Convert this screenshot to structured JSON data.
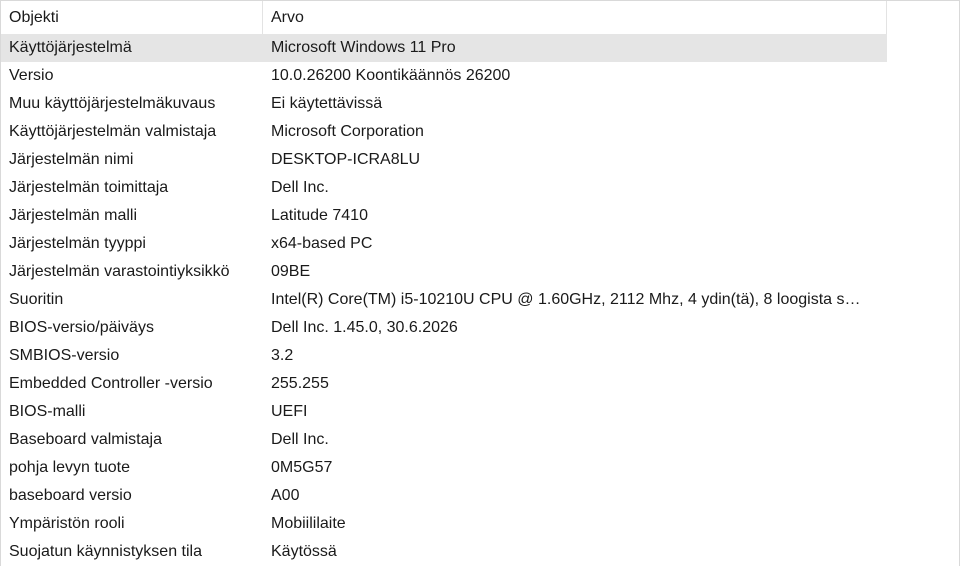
{
  "columns": {
    "item": "Objekti",
    "value": "Arvo"
  },
  "selected_index": 0,
  "rows": [
    {
      "item": "Käyttöjärjestelmä",
      "value": "Microsoft Windows 11 Pro"
    },
    {
      "item": "Versio",
      "value": "10.0.26200 Koontikäännös 26200"
    },
    {
      "item": "Muu käyttöjärjestelmäkuvaus",
      "value": "Ei käytettävissä"
    },
    {
      "item": "Käyttöjärjestelmän valmistaja",
      "value": "Microsoft Corporation"
    },
    {
      "item": "Järjestelmän nimi",
      "value": "DESKTOP-ICRA8LU"
    },
    {
      "item": "Järjestelmän toimittaja",
      "value": "Dell Inc."
    },
    {
      "item": "Järjestelmän malli",
      "value": "Latitude 7410"
    },
    {
      "item": "Järjestelmän tyyppi",
      "value": "x64-based PC"
    },
    {
      "item": "Järjestelmän varastointiyksikkö",
      "value": "09BE"
    },
    {
      "item": "Suoritin",
      "value": "Intel(R) Core(TM) i5-10210U CPU @ 1.60GHz, 2112 Mhz, 4 ydin(tä), 8 loogista s…"
    },
    {
      "item": "BIOS-versio/päiväys",
      "value": "Dell Inc. 1.45.0, 30.6.2026"
    },
    {
      "item": "SMBIOS-versio",
      "value": "3.2"
    },
    {
      "item": "Embedded Controller -versio",
      "value": "255.255"
    },
    {
      "item": "BIOS-malli",
      "value": "UEFI"
    },
    {
      "item": "Baseboard valmistaja",
      "value": "Dell Inc."
    },
    {
      "item": " pohja levyn tuote",
      "value": "0M5G57"
    },
    {
      "item": "baseboard versio",
      "value": "A00"
    },
    {
      "item": "Ympäristön rooli",
      "value": "Mobiililaite"
    },
    {
      "item": "Suojatun käynnistyksen tila",
      "value": "Käytössä"
    }
  ]
}
